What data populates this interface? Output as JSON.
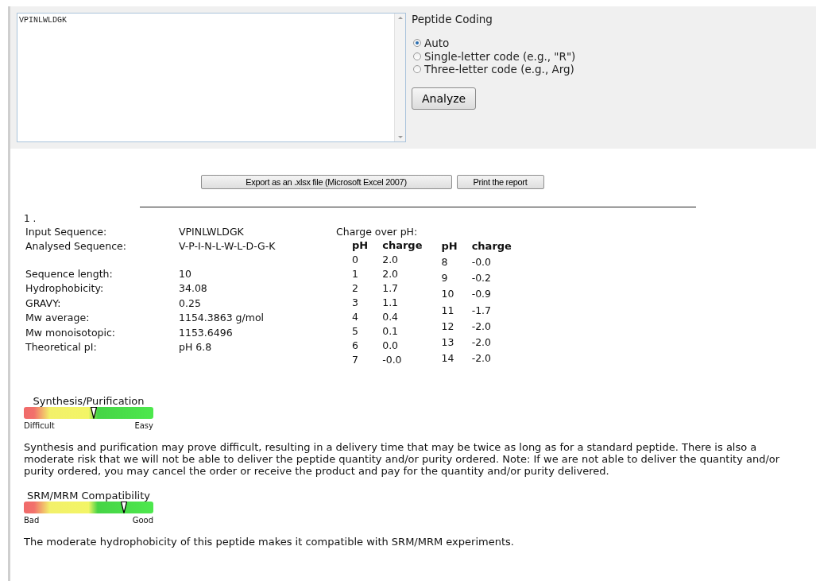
{
  "input": {
    "value": "VPINLWLDGK"
  },
  "peptide_coding": {
    "title": "Peptide Coding",
    "options": [
      {
        "label": "Auto",
        "selected": true
      },
      {
        "label": "Single-letter code (e.g., \"R\")",
        "selected": false
      },
      {
        "label": "Three-letter code (e.g., Arg)",
        "selected": false
      }
    ],
    "button": "Analyze"
  },
  "report_buttons": [
    "Export as an .xlsx file (Microsoft Excel 2007)",
    "Print the report"
  ],
  "result": {
    "index": "1 .",
    "properties": [
      {
        "label": "Input Sequence:",
        "value": "VPINLWLDGK"
      },
      {
        "label": "Analysed Sequence:",
        "value": "V-P-I-N-L-W-L-D-G-K"
      },
      {
        "label": "Sequence length:",
        "value": "10",
        "gap_before": true
      },
      {
        "label": "Hydrophobicity:",
        "value": "34.08"
      },
      {
        "label": "GRAVY:",
        "value": "0.25"
      },
      {
        "label": "Mw average:",
        "value": "1154.3863 g/mol"
      },
      {
        "label": "Mw monoisotopic:",
        "value": "1153.6496"
      },
      {
        "label": "Theoretical pI:",
        "value": "pH 6.8"
      }
    ],
    "charge": {
      "title": "Charge over pH:",
      "tables": [
        {
          "headers": [
            "pH",
            "charge"
          ],
          "rows": [
            [
              "0",
              "2.0"
            ],
            [
              "1",
              "2.0"
            ],
            [
              "2",
              "1.7"
            ],
            [
              "3",
              "1.1"
            ],
            [
              "4",
              "0.4"
            ],
            [
              "5",
              "0.1"
            ],
            [
              "6",
              "0.0"
            ],
            [
              "7",
              "-0.0"
            ]
          ]
        },
        {
          "headers": [
            "pH",
            "charge"
          ],
          "rows": [
            [
              "8",
              "-0.0"
            ],
            [
              "9",
              "-0.2"
            ],
            [
              "10",
              "-0.9"
            ],
            [
              "11",
              "-1.7"
            ],
            [
              "12",
              "-2.0"
            ],
            [
              "13",
              "-2.0"
            ],
            [
              "14",
              "-2.0"
            ]
          ]
        }
      ]
    },
    "meters": [
      {
        "title": "Synthesis/Purification",
        "level": 0.54,
        "low": "Difficult",
        "high": "Easy",
        "text": "Synthesis and purification may prove difficult, resulting in a delivery time that may be twice as long as for a standard peptide. There is also a moderate risk that we will not be able to deliver the peptide quantity and/or purity ordered. Note: If we are not able to deliver the quantity and/or purity ordered, you may cancel the order or receive the product and pay for the quantity and/or purity delivered."
      },
      {
        "title": "SRM/MRM Compatibility",
        "level": 0.77,
        "low": "Bad",
        "high": "Good",
        "text": "The moderate hydrophobicity of this peptide makes it compatible with SRM/MRM experiments."
      }
    ]
  }
}
